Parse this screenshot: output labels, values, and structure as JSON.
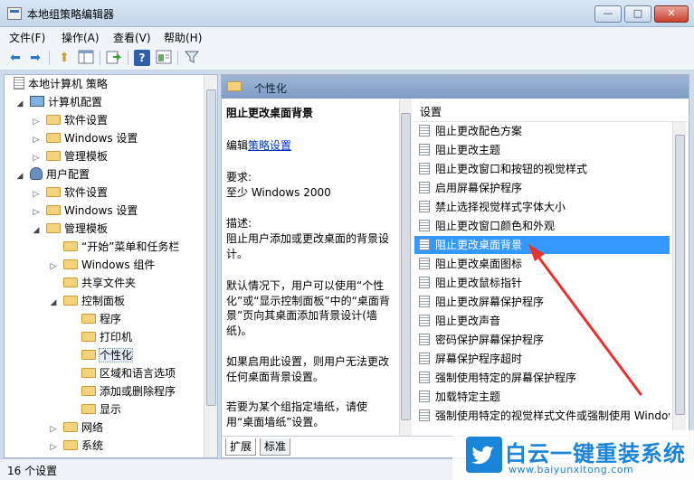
{
  "window": {
    "title": "本地组策略编辑器",
    "buttons": [
      "—",
      "□",
      "✕"
    ]
  },
  "menu": [
    "文件(F)",
    "操作(A)",
    "查看(V)",
    "帮助(H)"
  ],
  "toolbar": {
    "icons": [
      "back-icon",
      "forward-icon",
      "up-folder-icon",
      "show-hide-tree-icon",
      "export-icon",
      "help-icon",
      "properties-icon",
      "filter-icon"
    ]
  },
  "tree": [
    {
      "label": "本地计算机 策略",
      "expander": "",
      "icon": "computer-policy-icon"
    },
    {
      "label": "计算机配置",
      "expander": "◢",
      "icon": "computer-icon"
    },
    {
      "label": "软件设置",
      "expander": "▷",
      "icon": "folder-icon"
    },
    {
      "label": "Windows 设置",
      "expander": "▷",
      "icon": "folder-icon"
    },
    {
      "label": "管理模板",
      "expander": "▷",
      "icon": "folder-icon"
    },
    {
      "label": "用户配置",
      "expander": "◢",
      "icon": "user-icon"
    },
    {
      "label": "软件设置",
      "expander": "▷",
      "icon": "folder-icon"
    },
    {
      "label": "Windows 设置",
      "expander": "▷",
      "icon": "folder-icon"
    },
    {
      "label": "管理模板",
      "expander": "◢",
      "icon": "folder-icon"
    },
    {
      "label": "“开始”菜单和任务栏",
      "expander": "",
      "icon": "folder-icon"
    },
    {
      "label": "Windows 组件",
      "expander": "▷",
      "icon": "folder-icon"
    },
    {
      "label": "共享文件夹",
      "expander": "",
      "icon": "folder-icon"
    },
    {
      "label": "控制面板",
      "expander": "◢",
      "icon": "folder-icon"
    },
    {
      "label": "程序",
      "expander": "",
      "icon": "folder-icon"
    },
    {
      "label": "打印机",
      "expander": "",
      "icon": "folder-icon"
    },
    {
      "label": "个性化",
      "expander": "",
      "icon": "folder-icon",
      "selected": true
    },
    {
      "label": "区域和语言选项",
      "expander": "",
      "icon": "folder-icon"
    },
    {
      "label": "添加或删除程序",
      "expander": "",
      "icon": "folder-icon"
    },
    {
      "label": "显示",
      "expander": "",
      "icon": "folder-icon"
    },
    {
      "label": "网络",
      "expander": "▷",
      "icon": "folder-icon"
    },
    {
      "label": "系统",
      "expander": "▷",
      "icon": "folder-icon"
    }
  ],
  "right": {
    "header": "个性化",
    "desc": {
      "title": "阻止更改桌面背景",
      "edit_prefix": "编辑",
      "edit_link": "策略设置",
      "req_label": "要求:",
      "req_value": "至少 Windows 2000",
      "desc_label": "描述:",
      "desc_text": "阻止用户添加或更改桌面的背景设计。",
      "para1": "默认情况下，用户可以使用“个性化”或“显示控制面板”中的“桌面背景”页向其桌面添加背景设计(墙纸)。",
      "para2": "如果启用此设置，则用户无法更改任何桌面背景设置。",
      "para3": "若要为某个组指定墙纸，请使用“桌面墙纸”设置。"
    },
    "list_header": "设置",
    "settings": [
      "阻止更改配色方案",
      "阻止更改主题",
      "阻止更改窗口和按钮的视觉样式",
      "启用屏幕保护程序",
      "禁止选择视觉样式字体大小",
      "阻止更改窗口颜色和外观",
      "阻止更改桌面背景",
      "阻止更改桌面图标",
      "阻止更改鼠标指针",
      "阻止更改屏幕保护程序",
      "阻止更改声音",
      "密码保护屏幕保护程序",
      "屏幕保护程序超时",
      "强制使用特定的屏幕保护程序",
      "加载特定主题",
      "强制使用特定的视觉样式文件或强制使用 Windows 经典"
    ],
    "selected_index": 6,
    "tabs": [
      "扩展",
      "标准"
    ]
  },
  "status": "16 个设置",
  "watermark": {
    "title": "白云一键重装系统",
    "url": "www.baiyunxitong.com"
  },
  "colors": {
    "selection": "#3399ff",
    "arrow": "#e8322e",
    "link": "#0033cc",
    "brand": "#1a84d8"
  }
}
